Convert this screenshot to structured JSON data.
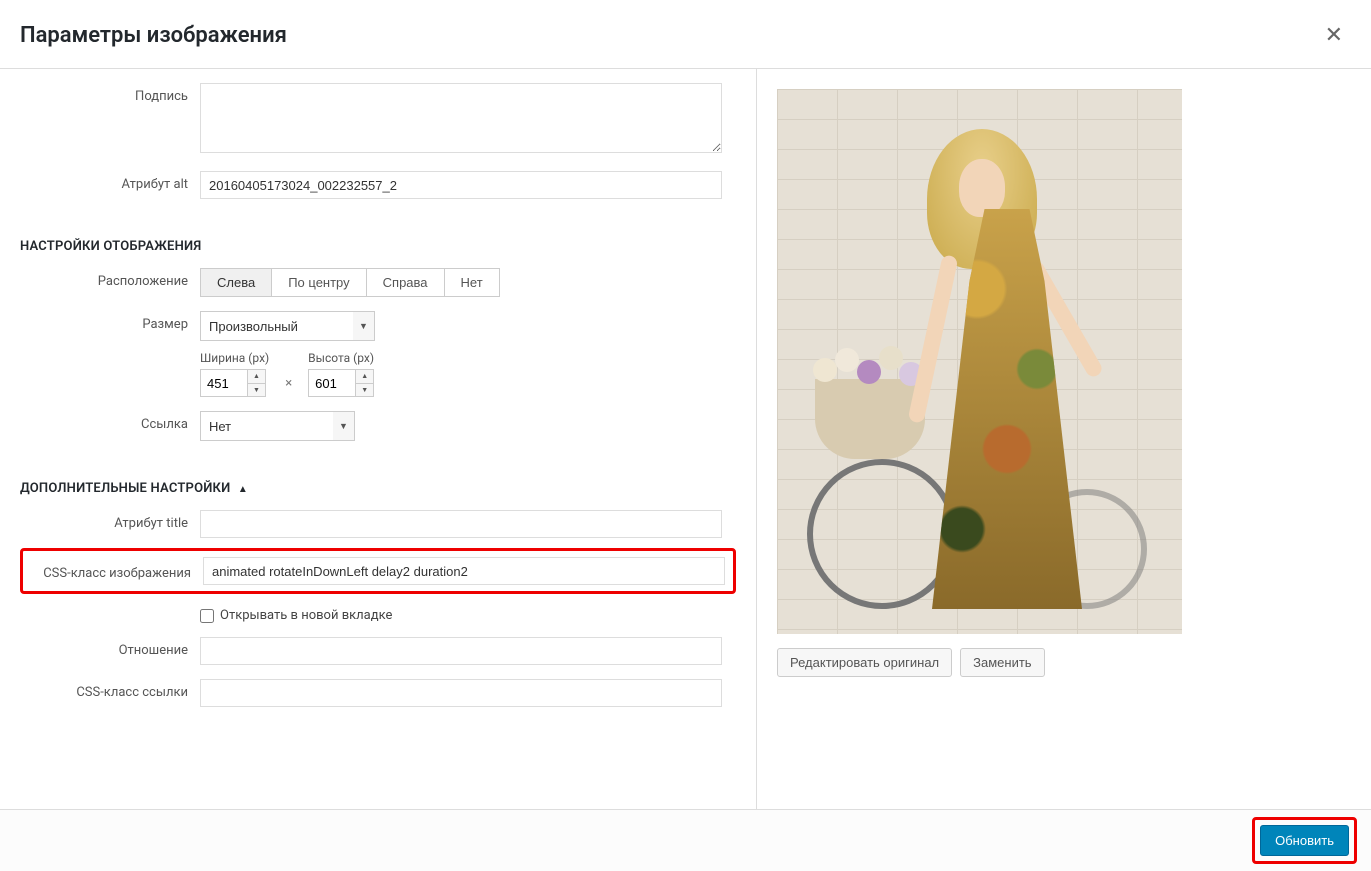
{
  "header": {
    "title": "Параметры изображения"
  },
  "fields": {
    "caption_label": "Подпись",
    "caption_value": "",
    "alt_label": "Атрибут alt",
    "alt_value": "20160405173024_002232557_2"
  },
  "display": {
    "section_title": "НАСТРОЙКИ ОТОБРАЖЕНИЯ",
    "align_label": "Расположение",
    "align_options": {
      "left": "Слева",
      "center": "По центру",
      "right": "Справа",
      "none": "Нет"
    },
    "align_active": "left",
    "size_label": "Размер",
    "size_value": "Произвольный",
    "width_label": "Ширина (px)",
    "width_value": "451",
    "mult_symbol": "×",
    "height_label": "Высота (px)",
    "height_value": "601",
    "link_label": "Ссылка",
    "link_value": "Нет"
  },
  "advanced": {
    "section_title": "ДОПОЛНИТЕЛЬНЫЕ НАСТРОЙКИ",
    "title_attr_label": "Атрибут title",
    "title_attr_value": "",
    "css_class_label": "CSS-класс изображения",
    "css_class_value": "animated rotateInDownLeft delay2 duration2",
    "new_tab_label": "Открывать в новой вкладке",
    "new_tab_checked": false,
    "rel_label": "Отношение",
    "rel_value": "",
    "link_css_label": "CSS-класс ссылки",
    "link_css_value": ""
  },
  "preview": {
    "edit_original": "Редактировать оригинал",
    "replace": "Заменить"
  },
  "footer": {
    "update": "Обновить"
  }
}
